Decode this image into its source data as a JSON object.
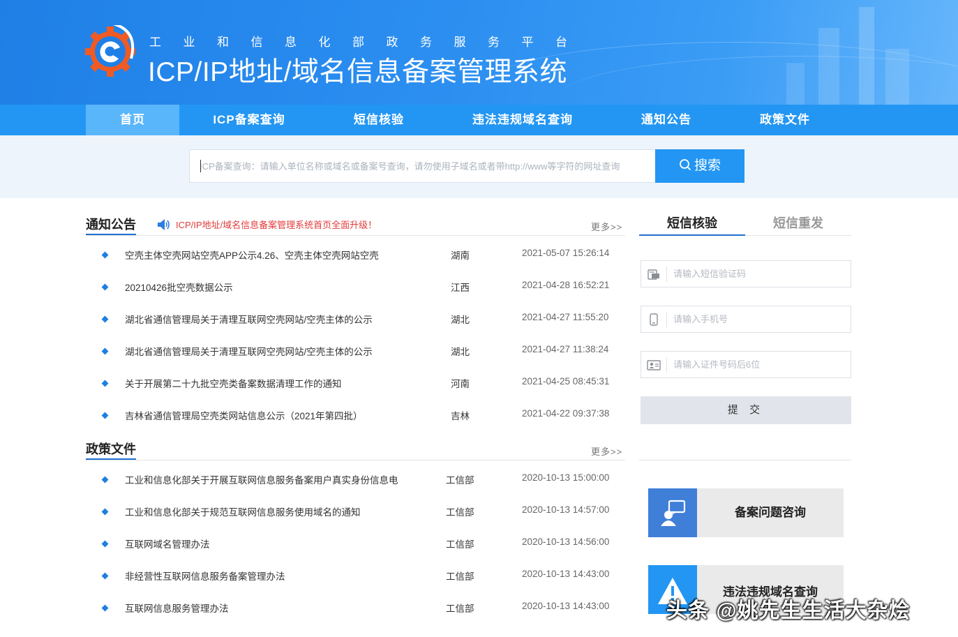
{
  "header": {
    "subtitle": "工业和信息化部政务服务平台",
    "title": "ICP/IP地址/域名信息备案管理系统"
  },
  "nav": {
    "items": [
      {
        "label": "首页",
        "active": true
      },
      {
        "label": "ICP备案查询",
        "active": false
      },
      {
        "label": "短信核验",
        "active": false
      },
      {
        "label": "违法违规域名查询",
        "active": false
      },
      {
        "label": "通知公告",
        "active": false
      },
      {
        "label": "政策文件",
        "active": false
      }
    ]
  },
  "search": {
    "placeholder": "ICP备案查询：请输入单位名称或域名或备案号查询，请勿使用子域名或者带http://www等字符的网址查询",
    "button_label": "搜索"
  },
  "notices": {
    "title": "通知公告",
    "banner": "ICP/IP地址/域名信息备案管理系统首页全面升级！",
    "more": "更多>>",
    "rows": [
      {
        "text": "空壳主体空壳网站空壳APP公示4.26、空壳主体空壳网站空壳",
        "region": "湖南",
        "time": "2021-05-07 15:26:14"
      },
      {
        "text": "20210426批空壳数据公示",
        "region": "江西",
        "time": "2021-04-28 16:52:21"
      },
      {
        "text": "湖北省通信管理局关于清理互联网空壳网站/空壳主体的公示",
        "region": "湖北",
        "time": "2021-04-27 11:55:20"
      },
      {
        "text": "湖北省通信管理局关于清理互联网空壳网站/空壳主体的公示",
        "region": "湖北",
        "time": "2021-04-27 11:38:24"
      },
      {
        "text": "关于开展第二十九批空壳类备案数据清理工作的通知",
        "region": "河南",
        "time": "2021-04-25 08:45:31"
      },
      {
        "text": "吉林省通信管理局空壳类网站信息公示（2021年第四批）",
        "region": "吉林",
        "time": "2021-04-22 09:37:38"
      }
    ]
  },
  "policies": {
    "title": "政策文件",
    "more": "更多>>",
    "rows": [
      {
        "text": "工业和信息化部关于开展互联网信息服务备案用户真实身份信息电",
        "region": "工信部",
        "time": "2020-10-13 15:00:00"
      },
      {
        "text": "工业和信息化部关于规范互联网信息服务使用域名的通知",
        "region": "工信部",
        "time": "2020-10-13 14:57:00"
      },
      {
        "text": "互联网域名管理办法",
        "region": "工信部",
        "time": "2020-10-13 14:56:00"
      },
      {
        "text": "非经营性互联网信息服务备案管理办法",
        "region": "工信部",
        "time": "2020-10-13 14:43:00"
      },
      {
        "text": "互联网信息服务管理办法",
        "region": "工信部",
        "time": "2020-10-13 14:43:00"
      }
    ]
  },
  "sms": {
    "tab_verify": "短信核验",
    "tab_resend": "短信重发",
    "code_placeholder": "请输入短信验证码",
    "phone_placeholder": "请输入手机号",
    "id_placeholder": "请输入证件号码后6位",
    "submit_label": "提 交"
  },
  "cards": {
    "consult_label": "备案问题咨询",
    "illegal_label": "违法违规域名查询"
  },
  "watermark": "头条 @姚先生生活大杂烩",
  "colors": {
    "primary": "#2396f3",
    "nav_active": "#5ab6fb",
    "notice_red": "#e33a3a",
    "bullet": "#1e7fe0"
  }
}
